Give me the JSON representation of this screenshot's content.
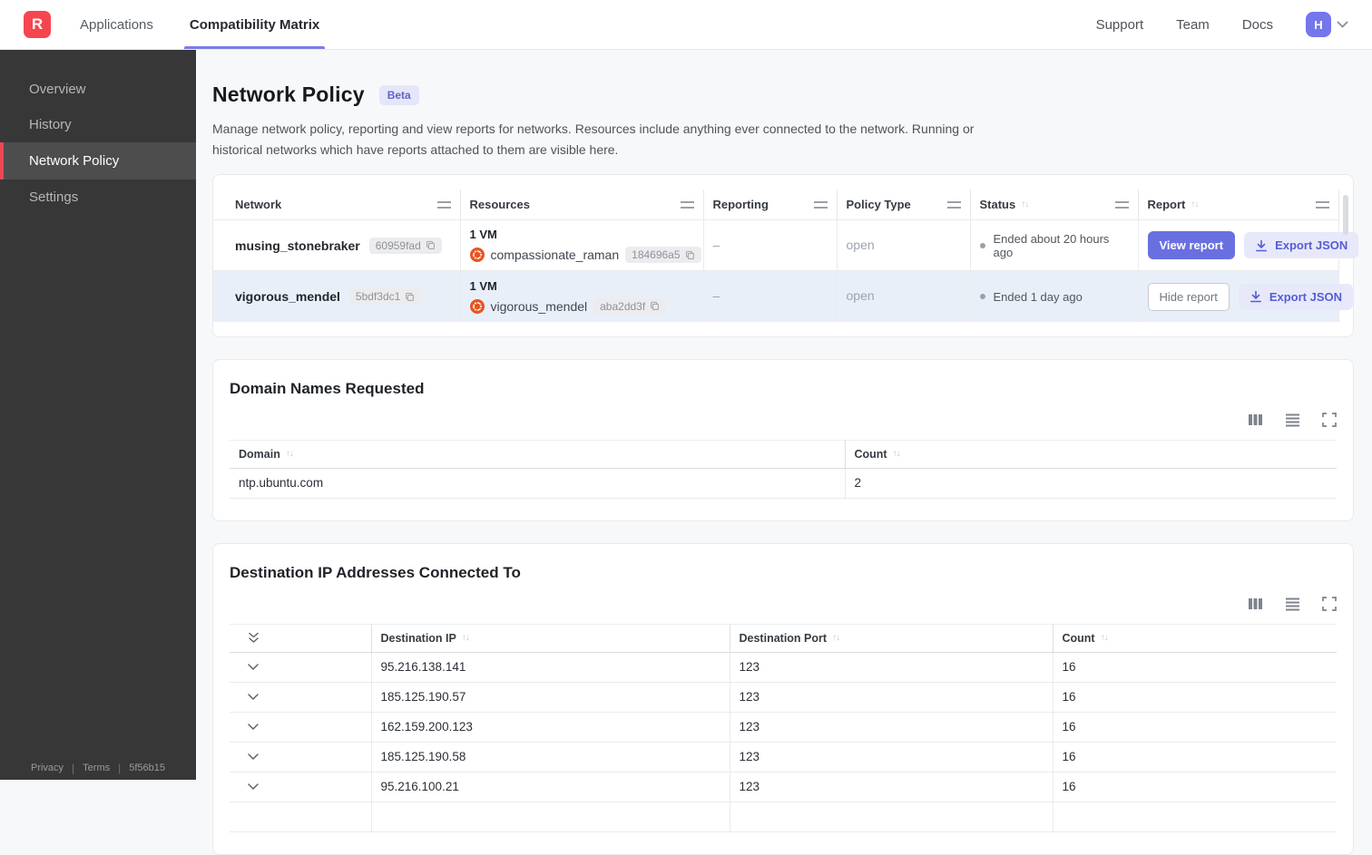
{
  "ui": {
    "sort": "↑↓"
  },
  "topnav": {
    "logo_letter": "R",
    "nav_items": [
      {
        "label": "Applications",
        "active": false
      },
      {
        "label": "Compatibility Matrix",
        "active": true
      }
    ],
    "right_links": [
      {
        "label": "Support"
      },
      {
        "label": "Team"
      },
      {
        "label": "Docs"
      }
    ],
    "avatar_letter": "H"
  },
  "sidebar": {
    "items": [
      {
        "label": "Overview",
        "active": false
      },
      {
        "label": "History",
        "active": false
      },
      {
        "label": "Network Policy",
        "active": true
      },
      {
        "label": "Settings",
        "active": false
      }
    ],
    "footer": {
      "privacy": "Privacy",
      "terms": "Terms",
      "build": "5f56b15"
    }
  },
  "page": {
    "title": "Network Policy",
    "beta_badge": "Beta",
    "description": "Manage network policy, reporting and view reports for networks. Resources include anything ever connected to the network. Running or historical networks which have reports attached to them are visible here."
  },
  "networks_table": {
    "headers": {
      "network": "Network",
      "resources": "Resources",
      "reporting": "Reporting",
      "policy_type": "Policy Type",
      "status": "Status",
      "report": "Report"
    },
    "rows": [
      {
        "name": "musing_stonebraker",
        "hash": "60959fad",
        "vm_count": "1 VM",
        "resource_name": "compassionate_raman",
        "resource_hash": "184696a5",
        "reporting": "–",
        "policy_type": "open",
        "status": "Ended about 20 hours ago",
        "report_action": "View report",
        "export_action": "Export JSON",
        "selected": false
      },
      {
        "name": "vigorous_mendel",
        "hash": "5bdf3dc1",
        "vm_count": "1 VM",
        "resource_name": "vigorous_mendel",
        "resource_hash": "aba2dd3f",
        "reporting": "–",
        "policy_type": "open",
        "status": "Ended 1 day ago",
        "report_action": "Hide report",
        "export_action": "Export JSON",
        "selected": true
      }
    ]
  },
  "domains": {
    "title": "Domain Names Requested",
    "headers": {
      "domain": "Domain",
      "count": "Count"
    },
    "rows": [
      {
        "domain": "ntp.ubuntu.com",
        "count": "2"
      }
    ]
  },
  "destinations": {
    "title": "Destination IP Addresses Connected To",
    "headers": {
      "ip": "Destination IP",
      "port": "Destination Port",
      "count": "Count"
    },
    "rows": [
      {
        "ip": "95.216.138.141",
        "port": "123",
        "count": "16"
      },
      {
        "ip": "185.125.190.57",
        "port": "123",
        "count": "16"
      },
      {
        "ip": "162.159.200.123",
        "port": "123",
        "count": "16"
      },
      {
        "ip": "185.125.190.58",
        "port": "123",
        "count": "16"
      },
      {
        "ip": "95.216.100.21",
        "port": "123",
        "count": "16"
      }
    ]
  },
  "colors": {
    "accent_indigo": "#6A6FE0",
    "brand_red": "#F5464F",
    "selected_row_bg": "#E9EFF9",
    "ubuntu_orange": "#E95420"
  }
}
